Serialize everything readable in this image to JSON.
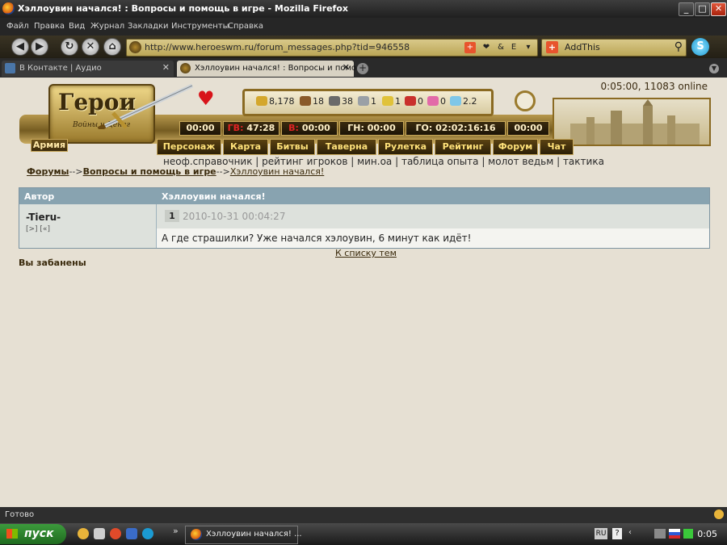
{
  "window": {
    "title": "Хэллоувин начался! : Вопросы и помощь в игре - Mozilla Firefox",
    "controls": {
      "minimize": "_",
      "maximize": "□",
      "close": "✕"
    }
  },
  "menu": [
    "Файл",
    "Правка",
    "Вид",
    "Журнал",
    "Закладки",
    "Инструменты",
    "Справка"
  ],
  "nav": {
    "url": "http://www.heroeswm.ru/forum_messages.php?tid=946558",
    "addthis_label": "AddThis",
    "back": "◀",
    "forward": "▶",
    "reload": "↻",
    "stop": "✕",
    "home": "⌂"
  },
  "tabs": [
    {
      "label": "В Контакте | Аудио",
      "close": "✕"
    },
    {
      "label": "Хэллоувин начался! : Вопросы и помо...",
      "close": "✕"
    }
  ],
  "tab_new": "+",
  "game": {
    "online": "0:05:00, 11083 online",
    "logo_title": "Герои",
    "logo_subtitle": "Войны и Денег",
    "resources": [
      {
        "icon": "gold-icon",
        "value": "8,178",
        "color": "#d4a72c"
      },
      {
        "icon": "wood-icon",
        "value": "18",
        "color": "#8a5a2a"
      },
      {
        "icon": "ore-icon",
        "value": "38",
        "color": "#6a6a6a"
      },
      {
        "icon": "mercury-icon",
        "value": "1",
        "color": "#9aa0a6"
      },
      {
        "icon": "sulfur-icon",
        "value": "1",
        "color": "#e0c23a"
      },
      {
        "icon": "crystal-icon",
        "value": "0",
        "color": "#c9302c"
      },
      {
        "icon": "gems-icon",
        "value": "0",
        "color": "#e26aa8"
      },
      {
        "icon": "diamond-icon",
        "value": "2.2",
        "color": "#7fc7e8"
      }
    ],
    "timers": [
      {
        "label": "",
        "red": "",
        "value": "00:00"
      },
      {
        "label": "",
        "red": "ГВ:",
        "value": "47:28"
      },
      {
        "label": "",
        "red": "В:",
        "value": "00:00"
      },
      {
        "label": "ГН:",
        "red": "",
        "value": "00:00"
      },
      {
        "label": "ГО:",
        "red": "",
        "value": "02:02:16:16"
      },
      {
        "label": "",
        "red": "",
        "value": "00:00"
      }
    ],
    "army_label": "Армия",
    "nav": [
      "Персонаж",
      "Карта",
      "Битвы",
      "Таверна",
      "Рулетка",
      "Рейтинг",
      "Форум",
      "Чат"
    ],
    "sublinks": "неоф.справочник | рейтинг игроков | мин.оа | таблица опыта | молот ведьм | тактика"
  },
  "breadcrumbs": {
    "forums": "Форумы",
    "sep1": "-->",
    "section": "Вопросы и помощь в игре",
    "sep2": "-->",
    "topic": "Хэллоувин начался!"
  },
  "forum": {
    "col_author": "Автор",
    "col_topic": "Хэллоувин начался!",
    "post": {
      "author": "-Tieru-",
      "author_links": "[>] [«]",
      "number": "1",
      "datetime": "2010-10-31 00:04:27",
      "message": "А где страшилки? Уже начался хэлоувин, 6 минут как идёт!"
    },
    "back_to_list": "К списку тем",
    "banned": "Вы забанены"
  },
  "status": {
    "text": "Готово"
  },
  "taskbar": {
    "start": "пуск",
    "active_window": "Хэллоувин начался! ...",
    "lang": "RU",
    "clock": "0:05",
    "quicklaunch_chevron": "»"
  }
}
